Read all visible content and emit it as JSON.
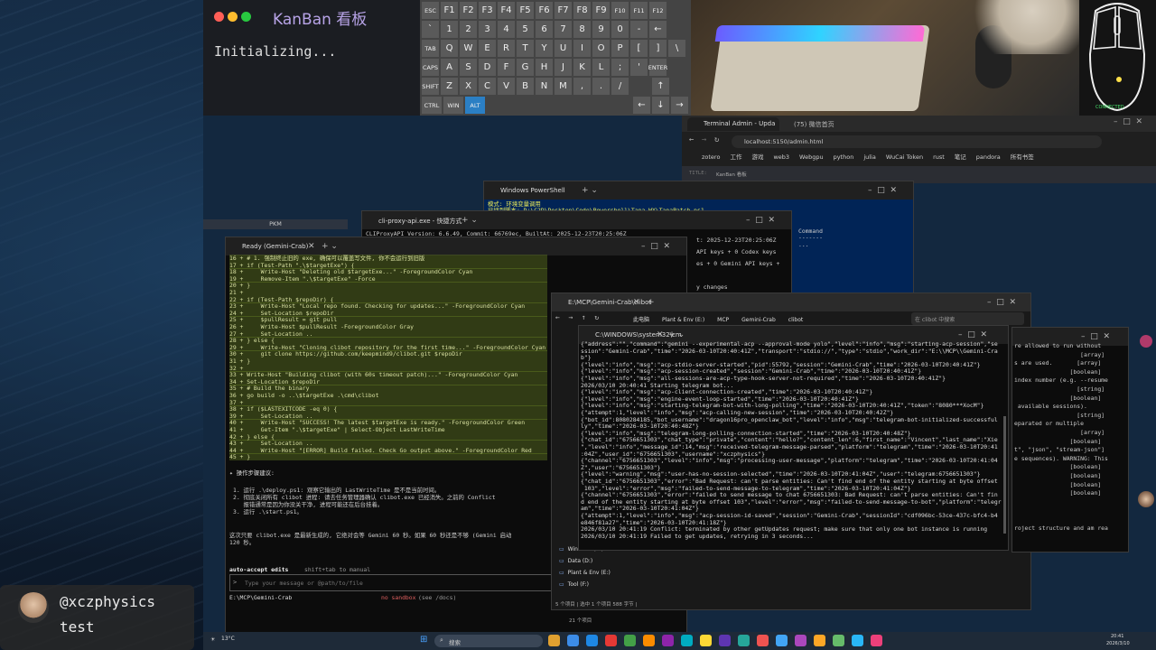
{
  "kanban": {
    "title": "KanBan 看板",
    "status": "Initializing..."
  },
  "keyboard": {
    "row1": [
      "ESC",
      "F1",
      "F2",
      "F3",
      "F4",
      "F5",
      "F6",
      "F7",
      "F8",
      "F9",
      "F10",
      "F11",
      "F12"
    ],
    "row2": [
      "`",
      "1",
      "2",
      "3",
      "4",
      "5",
      "6",
      "7",
      "8",
      "9",
      "0",
      "-",
      "←"
    ],
    "row3": [
      "TAB",
      "Q",
      "W",
      "E",
      "R",
      "T",
      "Y",
      "U",
      "I",
      "O",
      "P",
      "[",
      "]",
      "\\"
    ],
    "row4": [
      "CAPS",
      "A",
      "S",
      "D",
      "F",
      "G",
      "H",
      "J",
      "K",
      "L",
      ";",
      "'",
      "ENTER"
    ],
    "row5": [
      "SHIFT",
      "Z",
      "X",
      "C",
      "V",
      "B",
      "N",
      "M",
      ",",
      ".",
      "/",
      "↑"
    ],
    "row6": [
      "CTRL",
      "WIN",
      "ALT",
      "←",
      "↓",
      "→"
    ]
  },
  "browser": {
    "tab1": "Terminal Admin - Upda",
    "tab2": "(75) 微信首页",
    "url": "localhost:5150/admin.html",
    "bookmarks": [
      "zotero",
      "工作",
      "游戏",
      "web3",
      "Webgpu",
      "python",
      "julia",
      "WuCai Token",
      "rust",
      "笔记",
      "pandora",
      "所有书签"
    ],
    "page_label": "TITLE:",
    "page_value": "KanBan 看板"
  },
  "pkm_label": "PKM",
  "powershell": {
    "title": "Windows PowerShell",
    "line1": "模式: 环境变量调用",
    "line2": "已找到脚本: D:\\C2D\\Desktop\\Code\\Powershell\\Tana_WX\\TanaPatch.ps1"
  },
  "cliproxy": {
    "title": "cli-proxy-api.exe - 快捷方式",
    "line1": "CLIProxyAPI Version: 6.6.49, Commit: 66769ec, BuiltAt: 2025-12-23T20:25:06Z",
    "right_lines": [
      "t: 2025-12-23T20:25:06Z",
      "API keys + 0 Codex keys",
      "es + 0 Gemini API keys +",
      "",
      "y changes"
    ],
    "cmd_head": "Command",
    "cmd_sep": "-------",
    "cmd_dots": "..."
  },
  "gemini": {
    "title": "Ready (Gemini-Crab)",
    "code": [
      "16 + # 1. 强制终止旧的 exe, 确保可以覆盖写文件, 你不会运行到旧版",
      "17 + if (Test-Path \".\\$targetExe\") {",
      "18 +     Write-Host \"Deleting old $targetExe...\" -ForegroundColor Cyan",
      "19 +     Remove-Item \".\\$targetExe\" -Force",
      "20 + }",
      "21 +",
      "22 + if (Test-Path $repoDir) {",
      "23 +     Write-Host \"Local repo found. Checking for updates...\" -ForegroundColor Cyan",
      "24 +     Set-Location $repoDir",
      "25 +     $pullResult = git pull",
      "26 +     Write-Host $pullResult -ForegroundColor Gray",
      "27 +     Set-Location ..",
      "28 + } else {",
      "29 +     Write-Host \"Cloning clibot repository for the first time...\" -ForegroundColor Cyan",
      "30 +     git clone https://github.com/keepmind9/clibot.git $repoDir",
      "31 + }",
      "32 +",
      "33 + Write-Host \"Building clibot (with 60s timeout patch)...\" -ForegroundColor Cyan",
      "34 + Set-Location $repoDir",
      "35 + # Build the binary",
      "36 + go build -o ..\\$targetExe .\\cmd\\clibot",
      "37 +",
      "38 + if ($LASTEXITCODE -eq 0) {",
      "39 +     Set-Location ..",
      "40 +     Write-Host \"SUCCESS! The latest $targetExe is ready.\" -ForegroundColor Green",
      "41 +     Get-Item \".\\$targetExe\" | Select-Object LastWriteTime",
      "42 + } else {",
      "43 +     Set-Location ..",
      "44 +     Write-Host \"[ERROR] Build failed. Check Go output above.\" -ForegroundColor Red",
      "45 + }"
    ],
    "steps_head": "✦ 操作步骤建议:",
    "steps": [
      "1. 运行 .\\deploy.ps1: 观察它输出的 LastWriteTime 是不是当前时间。",
      "2. 彻底关闭所有 clibot 进程: 请去任务管理器确认 clibot.exe 已经消失。之前的 Conflict",
      "   报错通常是因为你没关干净, 进程可能还在后台挂着。",
      "3. 运行 .\\start.ps1。"
    ],
    "note": "这次只要 clibot.exe 是最新生成的, 它绝对会等 Gemini 60 秒。如果 60 秒还是不够 (Gemini 启动",
    "note2": "120 秒。",
    "accept": "auto-accept edits",
    "accept_hint": "shift+tab to manual",
    "input_placeholder": "Type your message or @path/to/file",
    "cwd": "E:\\MCP\\Gemini-Crab",
    "sandbox": "no sandbox",
    "sandbox_hint": "(see /docs)"
  },
  "explorer": {
    "title": "E:\\MCP\\Gemini-Crab\\clibot",
    "breadcrumb": [
      "此电脑",
      "Plant & Env (E:)",
      "MCP",
      "Gemini-Crab",
      "clibot"
    ],
    "search": "在 clibot 中搜索",
    "drives": [
      "Windows (C:)",
      "Data (D:)",
      "Plant & Env (E:)",
      "Tool (F:)"
    ],
    "status": "5 个项目 | 选中 1 个项目 588 字节 |",
    "status2": "21 个项目"
  },
  "cmd": {
    "title": "C:\\WINDOWS\\system32\\cm",
    "lines": [
      "{\"address\":\"\",\"command\":\"gemini --experimental-acp --approval-mode yolo\",\"level\":\"info\",\"msg\":\"starting-acp-session\",\"se",
      "ssion\":\"Gemini-Crab\",\"time\":\"2026-03-10T20:40:41Z\",\"transport\":\"stdio://\",\"type\":\"stdio\",\"work_dir\":\"E:\\\\MCP\\\\Gemini-Cra",
      "b\"}",
      "{\"level\":\"info\",\"msg\":\"acp-stdio-server-started\",\"pid\":55792,\"session\":\"Gemini-Crab\",\"time\":\"2026-03-10T20:40:41Z\"}",
      "{\"level\":\"info\",\"msg\":\"acp-session-created\",\"session\":\"Gemini-Crab\",\"time\":\"2026-03-10T20:40:41Z\"}",
      "{\"level\":\"info\",\"msg\":\"all-sessions-are-acp-type-hook-server-not-required\",\"time\":\"2026-03-10T20:40:41Z\"}",
      "2026/03/10 20:40:41 Starting telegram bot...",
      "{\"level\":\"info\",\"msg\":\"acp-client-connection-created\",\"time\":\"2026-03-10T20:40:41Z\"}",
      "{\"level\":\"info\",\"msg\":\"engine-event-loop-started\",\"time\":\"2026-03-10T20:40:41Z\"}",
      "{\"level\":\"info\",\"msg\":\"starting-telegram-bot-with-long-polling\",\"time\":\"2026-03-10T20:40:41Z\",\"token\":\"8080***XocM\"}",
      "{\"attempt\":1,\"level\":\"info\",\"msg\":\"acp-calling-new-session\",\"time\":\"2026-03-10T20:40:42Z\"}",
      "{\"bot_id\":8080284185,\"bot_username\":\"dragon16pro_openclaw_bot\",\"level\":\"info\",\"msg\":\"telegram-bot-initialized-successful",
      "ly\",\"time\":\"2026-03-10T20:40:48Z\"}",
      "{\"level\":\"info\",\"msg\":\"telegram-long-polling-connection-started\",\"time\":\"2026-03-10T20:40:48Z\"}",
      "{\"chat_id\":\"6756651303\",\"chat_type\":\"private\",\"content\":\"hello?\",\"content_len\":6,\"first_name\":\"Vincent\",\"last_name\":\"Xie",
      "\",\"level\":\"info\",\"message_id\":14,\"msg\":\"received-telegram-message-parsed\",\"platform\":\"telegram\",\"time\":\"2026-03-10T20:41",
      ":04Z\",\"user_id\":\"6756651303\",\"username\":\"xczphysics\"}",
      "{\"channel\":\"6756651303\",\"level\":\"info\",\"msg\":\"processing-user-message\",\"platform\":\"telegram\",\"time\":\"2026-03-10T20:41:04",
      "Z\",\"user\":\"6756651303\"}",
      "{\"level\":\"warning\",\"msg\":\"user-has-no-session-selected\",\"time\":\"2026-03-10T20:41:04Z\",\"user\":\"telegram:6756651303\"}",
      "{\"chat_id\":\"6756651303\",\"error\":\"Bad Request: can't parse entities: Can't find end of the entity starting at byte offset",
      " 103\",\"level\":\"error\",\"msg\":\"failed-to-send-message-to-telegram\",\"time\":\"2026-03-10T20:41:04Z\"}",
      "{\"channel\":\"6756651303\",\"error\":\"failed to send message to chat 6756651303: Bad Request: can't parse entities: Can't fin",
      "d end of the entity starting at byte offset 103\",\"level\":\"error\",\"msg\":\"failed-to-send-message-to-bot\",\"platform\":\"telegr",
      "am\",\"time\":\"2026-03-10T20:41:04Z\"}",
      "{\"attempt\":1,\"level\":\"info\",\"msg\":\"acp-session-id-saved\",\"session\":\"Gemini-Crab\",\"sessionId\":\"cdf096bc-53ce-437c-bfc4-b4",
      "e846f81a27\",\"time\":\"2026-03-10T20:41:18Z\"}",
      "2026/03/10 20:41:19 Conflict: terminated by other getUpdates request; make sure that only one bot instance is running",
      "2026/03/10 20:41:19 Failed to get updates, retrying in 3 seconds..."
    ]
  },
  "help": {
    "lines": [
      "re allowed to run without",
      "                   [array]",
      "s are used.       [array]",
      "                [boolean]",
      "index number (e.g. --resume",
      "                  [string]",
      "                [boolean]",
      " available sessions).",
      "                  [string]",
      "eparated or multiple",
      "                   [array]",
      "                [boolean]",
      "t\", \"json\", \"stream-json\"]",
      "e sequences). WARNING: This",
      "                [boolean]",
      "                [boolean]",
      "                [boolean]",
      "                [boolean]",
      "",
      "",
      "",
      "roject structure and am rea"
    ]
  },
  "stream": {
    "user": "@xczphysics",
    "status": "test"
  },
  "taskbar": {
    "weather": "13°C",
    "search": "搜索",
    "time": "20:41",
    "date": "2026/3/10"
  },
  "mouse_label": "CONNECTED"
}
